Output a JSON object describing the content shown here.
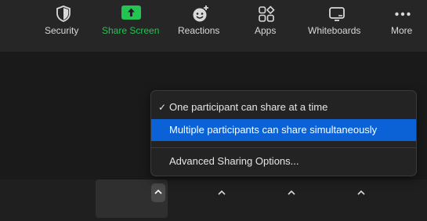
{
  "toolbar": {
    "security": {
      "label": "Security",
      "icon": "shield-icon"
    },
    "share_screen": {
      "label": "Share Screen",
      "icon": "share-screen-arrow-icon",
      "accent": "#23c552"
    },
    "reactions": {
      "label": "Reactions",
      "icon": "smiley-plus-icon"
    },
    "apps": {
      "label": "Apps",
      "icon": "apps-icon"
    },
    "whiteboards": {
      "label": "Whiteboards",
      "icon": "whiteboard-icon"
    },
    "more": {
      "label": "More",
      "icon": "more-dots-icon"
    }
  },
  "share_menu": {
    "items": [
      {
        "label": "One participant can share at a time",
        "checked": true,
        "selected": false
      },
      {
        "label": "Multiple participants can share simultaneously",
        "checked": false,
        "selected": true
      },
      {
        "label": "Advanced Sharing Options...",
        "checked": false,
        "selected": false
      }
    ],
    "check_glyph": "✓",
    "highlight_color": "#0a62d6"
  }
}
